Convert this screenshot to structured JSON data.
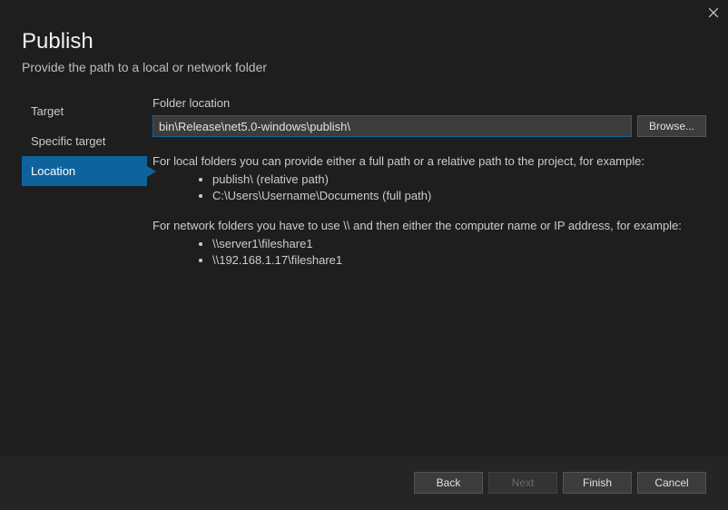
{
  "header": {
    "title": "Publish",
    "subtitle": "Provide the path to a local or network folder"
  },
  "sidebar": {
    "items": [
      {
        "label": "Target",
        "active": false
      },
      {
        "label": "Specific target",
        "active": false
      },
      {
        "label": "Location",
        "active": true
      }
    ]
  },
  "content": {
    "field_label": "Folder location",
    "input_value": "bin\\Release\\net5.0-windows\\publish\\",
    "browse_label": "Browse...",
    "help_local_intro": "For local folders you can provide either a full path or a relative path to the project, for example:",
    "help_local_examples": [
      "publish\\ (relative path)",
      "C:\\Users\\Username\\Documents (full path)"
    ],
    "help_network_intro": "For network folders you have to use \\\\ and then either the computer name or IP address, for example:",
    "help_network_examples": [
      "\\\\server1\\fileshare1",
      "\\\\192.168.1.17\\fileshare1"
    ]
  },
  "footer": {
    "back_label": "Back",
    "next_label": "Next",
    "finish_label": "Finish",
    "cancel_label": "Cancel"
  }
}
